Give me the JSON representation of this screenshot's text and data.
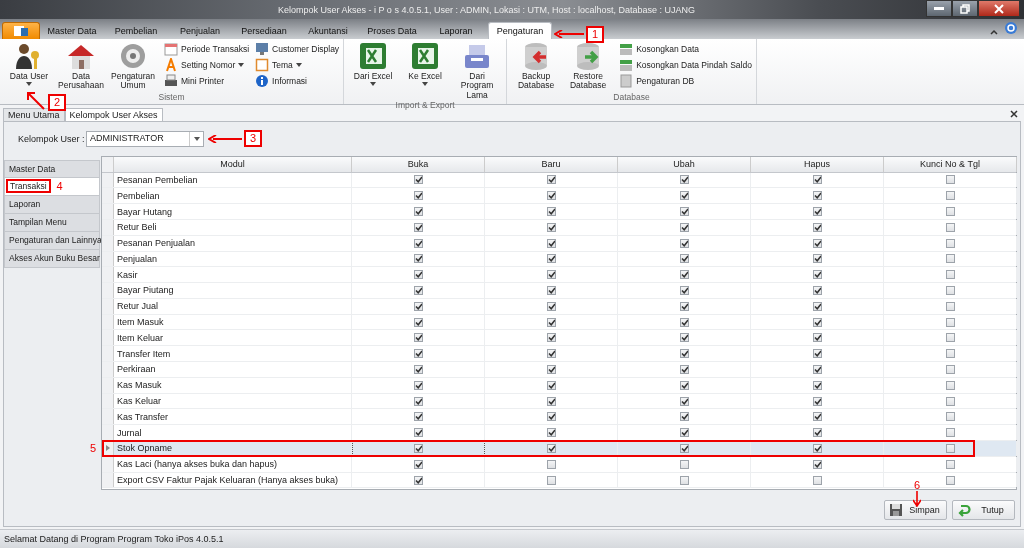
{
  "window": {
    "title": "Kelompok User Akses - i P o s 4.0.5.1,  User : ADMIN, Lokasi : UTM, Host : localhost, Database : UJANG"
  },
  "ribbon_tabs": [
    {
      "label": "Master Data",
      "selected": false
    },
    {
      "label": "Pembelian",
      "selected": false
    },
    {
      "label": "Penjualan",
      "selected": false
    },
    {
      "label": "Persediaan",
      "selected": false
    },
    {
      "label": "Akuntansi",
      "selected": false
    },
    {
      "label": "Proses Data",
      "selected": false
    },
    {
      "label": "Laporan",
      "selected": false
    },
    {
      "label": "Pengaturan",
      "selected": true,
      "callout": "1"
    }
  ],
  "ribbon_groups": [
    {
      "label": "Sistem",
      "large": [
        {
          "label": "Data User",
          "dropdown": true,
          "callout": "2"
        },
        {
          "label": "Data Perusahaan",
          "dropdown": false
        },
        {
          "label": "Pengaturan Umum",
          "dropdown": false
        }
      ],
      "small": [
        {
          "label": "Periode Transaksi",
          "dropdown": false
        },
        {
          "label": "Setting Nomor",
          "dropdown": true
        },
        {
          "label": "Mini Printer",
          "dropdown": false
        },
        {
          "label": "Customer Display",
          "dropdown": false
        },
        {
          "label": "Tema",
          "dropdown": true
        },
        {
          "label": "Informasi",
          "dropdown": false
        }
      ]
    },
    {
      "label": "Import & Export",
      "large": [
        {
          "label": "Dari Excel",
          "dropdown": true
        },
        {
          "label": "Ke Excel",
          "dropdown": true
        },
        {
          "label": "Dari Program Lama",
          "dropdown": false
        }
      ]
    },
    {
      "label": "Database",
      "large": [
        {
          "label": "Backup Database",
          "dropdown": false
        },
        {
          "label": "Restore Database",
          "dropdown": false
        }
      ],
      "small": [
        {
          "label": "Kosongkan Data",
          "dropdown": false
        },
        {
          "label": "Kosongkan Data Pindah Saldo",
          "dropdown": false
        },
        {
          "label": "Pengaturan DB",
          "dropdown": false
        }
      ]
    }
  ],
  "doc_tabs": [
    {
      "label": "Menu Utama",
      "selected": false
    },
    {
      "label": "Kelompok User Akses",
      "selected": true
    }
  ],
  "filter": {
    "label": "Kelompok User :",
    "value": "ADMINISTRATOR",
    "callout": "3"
  },
  "sections": [
    {
      "label": "Master Data",
      "selected": false
    },
    {
      "label": "Transaksi",
      "selected": true,
      "callout": "4"
    },
    {
      "label": "Laporan",
      "selected": false
    },
    {
      "label": "Tampilan Menu",
      "selected": false
    },
    {
      "label": "Pengaturan dan Lainnya",
      "selected": false
    },
    {
      "label": "Akses Akun Buku Besar",
      "selected": false
    }
  ],
  "table": {
    "columns": [
      "Modul",
      "Buka",
      "Baru",
      "Ubah",
      "Hapus",
      "Kunci No & Tgl"
    ],
    "rows": [
      {
        "modul": "Pesanan Pembelian",
        "checks": [
          true,
          true,
          true,
          true,
          false
        ],
        "current": false
      },
      {
        "modul": "Pembelian",
        "checks": [
          true,
          true,
          true,
          true,
          false
        ],
        "current": false
      },
      {
        "modul": "Bayar Hutang",
        "checks": [
          true,
          true,
          true,
          true,
          false
        ],
        "current": false
      },
      {
        "modul": "Retur Beli",
        "checks": [
          true,
          true,
          true,
          true,
          false
        ],
        "current": false
      },
      {
        "modul": "Pesanan Penjualan",
        "checks": [
          true,
          true,
          true,
          true,
          false
        ],
        "current": false
      },
      {
        "modul": "Penjualan",
        "checks": [
          true,
          true,
          true,
          true,
          false
        ],
        "current": false
      },
      {
        "modul": "Kasir",
        "checks": [
          true,
          true,
          true,
          true,
          false
        ],
        "current": false
      },
      {
        "modul": "Bayar Piutang",
        "checks": [
          true,
          true,
          true,
          true,
          false
        ],
        "current": false
      },
      {
        "modul": "Retur Jual",
        "checks": [
          true,
          true,
          true,
          true,
          false
        ],
        "current": false
      },
      {
        "modul": "Item Masuk",
        "checks": [
          true,
          true,
          true,
          true,
          false
        ],
        "current": false
      },
      {
        "modul": "Item Keluar",
        "checks": [
          true,
          true,
          true,
          true,
          false
        ],
        "current": false
      },
      {
        "modul": "Transfer Item",
        "checks": [
          true,
          true,
          true,
          true,
          false
        ],
        "current": false
      },
      {
        "modul": "Perkiraan",
        "checks": [
          true,
          true,
          true,
          true,
          false
        ],
        "current": false
      },
      {
        "modul": "Kas Masuk",
        "checks": [
          true,
          true,
          true,
          true,
          false
        ],
        "current": false
      },
      {
        "modul": "Kas Keluar",
        "checks": [
          true,
          true,
          true,
          true,
          false
        ],
        "current": false
      },
      {
        "modul": "Kas Transfer",
        "checks": [
          true,
          true,
          true,
          true,
          false
        ],
        "current": false
      },
      {
        "modul": "Jurnal",
        "checks": [
          true,
          true,
          true,
          true,
          false
        ],
        "current": false
      },
      {
        "modul": "Stok Opname",
        "checks": [
          true,
          true,
          true,
          true,
          false
        ],
        "current": true,
        "callout": "5"
      },
      {
        "modul": "Kas Laci (hanya akses buka dan hapus)",
        "checks": [
          true,
          false,
          false,
          true,
          false
        ],
        "current": false
      },
      {
        "modul": "Export CSV Faktur Pajak Keluaran (Hanya akses buka)",
        "checks": [
          true,
          false,
          false,
          false,
          false
        ],
        "current": false
      }
    ]
  },
  "buttons": [
    {
      "label": "Simpan",
      "kind": "save",
      "callout": "6"
    },
    {
      "label": "Tutup",
      "kind": "close"
    }
  ],
  "status_bar": "Selamat Datang di Program Program Toko iPos 4.0.5.1"
}
